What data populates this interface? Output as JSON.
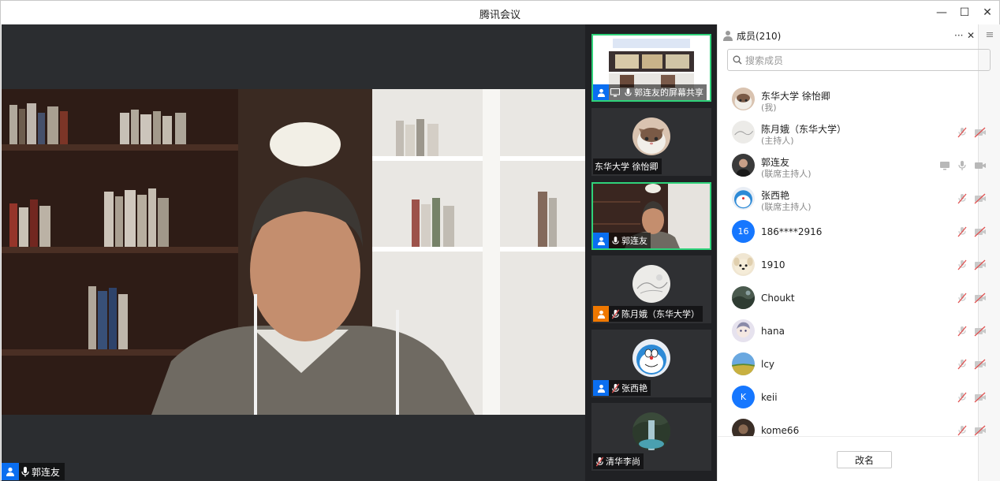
{
  "window": {
    "title": "腾讯会议",
    "minimize": "—",
    "maximize": "☐",
    "close": "✕"
  },
  "main_video": {
    "speaker_name": "郭连友"
  },
  "strip": {
    "tiles": [
      {
        "name": "郭连友的屏幕共享",
        "active": true
      },
      {
        "name": "东华大学 徐怡卿",
        "active": false
      },
      {
        "name": "郭连友",
        "active": true
      },
      {
        "name": "陈月娥（东华大学）",
        "active": false
      },
      {
        "name": "张西艳",
        "active": false
      },
      {
        "name": "清华李尚",
        "active": false
      }
    ]
  },
  "panel": {
    "title": "成员(210)",
    "more": "···",
    "close": "✕",
    "menu": "≡",
    "search_placeholder": "搜索成员",
    "rename_label": "改名",
    "members": [
      {
        "name": "东华大学 徐怡卿",
        "role": "(我)",
        "avatar": "cat-avatar"
      },
      {
        "name": "陈月娥（东华大学）",
        "role": "(主持人)",
        "avatar": "sketch-avatar"
      },
      {
        "name": "郭连友",
        "role": "(联席主持人)",
        "avatar": "photo-avatar"
      },
      {
        "name": "张西艳",
        "role": "(联席主持人)",
        "avatar": "doraemon-avatar"
      },
      {
        "name": "186****2916",
        "role": "",
        "avatar": "16",
        "avatar_color": "#1677ff"
      },
      {
        "name": "1910",
        "role": "",
        "avatar": "dog-avatar"
      },
      {
        "name": "Choukt",
        "role": "",
        "avatar": "landscape-avatar"
      },
      {
        "name": "hana",
        "role": "",
        "avatar": "anime-avatar"
      },
      {
        "name": "lcy",
        "role": "",
        "avatar": "field-avatar"
      },
      {
        "name": "keii",
        "role": "",
        "avatar": "K",
        "avatar_color": "#1677ff"
      },
      {
        "name": "kome66",
        "role": "",
        "avatar": "dark-avatar"
      }
    ]
  },
  "colors": {
    "accent_blue": "#0a6ef0",
    "active_border": "#2fd27a",
    "muted_red": "#e05252"
  }
}
